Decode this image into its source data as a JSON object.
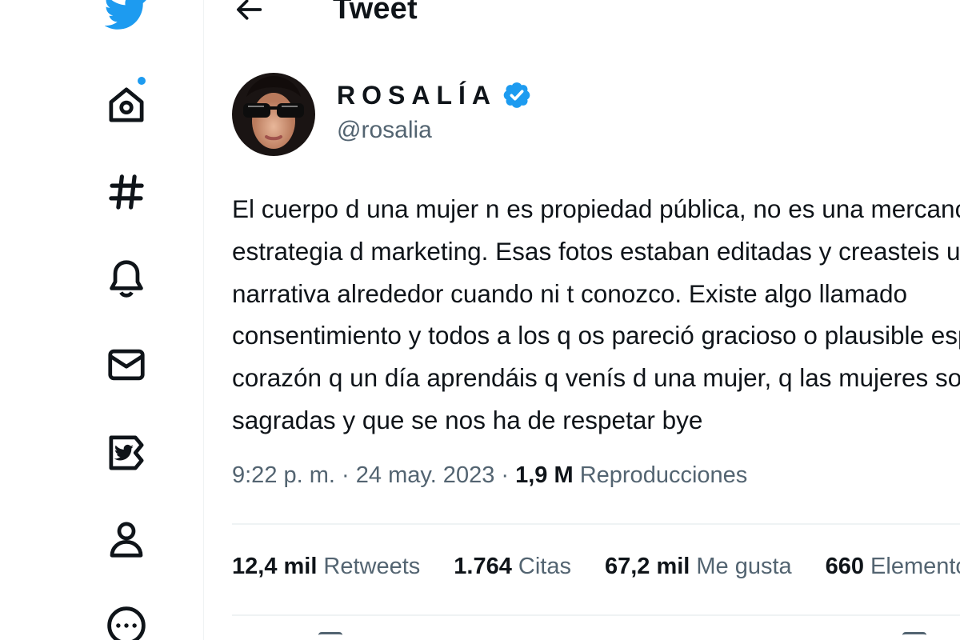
{
  "header": {
    "title": "Tweet"
  },
  "sidebar": {
    "items": [
      {
        "name": "logo",
        "icon": "twitter-bird-icon"
      },
      {
        "name": "home",
        "icon": "home-icon",
        "has_notification_dot": true
      },
      {
        "name": "explore",
        "icon": "hashtag-icon"
      },
      {
        "name": "notifications",
        "icon": "bell-icon"
      },
      {
        "name": "messages",
        "icon": "mail-icon"
      },
      {
        "name": "verified",
        "icon": "twitter-blue-icon"
      },
      {
        "name": "profile",
        "icon": "person-icon"
      },
      {
        "name": "more",
        "icon": "more-circle-icon"
      }
    ]
  },
  "tweet": {
    "author": {
      "name": "ROSALÍA",
      "handle": "@rosalia",
      "verified": true
    },
    "text_lines": [
      "El cuerpo d una mujer n es propiedad pública, no es una mercancía pa una",
      "estrategia d marketing. Esas fotos estaban editadas y creasteis una falsa",
      "narrativa alrededor cuando ni t conozco. Existe algo llamado",
      "consentimiento y todos a los q os pareció gracioso o plausible espero de",
      "corazón q un día aprendáis q venís d una mujer, q las mujeres son",
      "sagradas y que se nos ha de respetar bye"
    ],
    "meta": {
      "time": "9:22 p. m.",
      "date": "24 may. 2023",
      "views_count": "1,9 M",
      "views_label": "Reproducciones"
    },
    "stats": {
      "retweets_count": "12,4 mil",
      "retweets_label": "Retweets",
      "quotes_count": "1.764",
      "quotes_label": "Citas",
      "likes_count": "67,2 mil",
      "likes_label": "Me gusta",
      "bookmarks_count": "660",
      "bookmarks_label": "Elementos guardados"
    }
  },
  "colors": {
    "accent": "#1d9bf0",
    "text_primary": "#0f1419",
    "text_secondary": "#536471",
    "divider": "#eff3f4"
  }
}
